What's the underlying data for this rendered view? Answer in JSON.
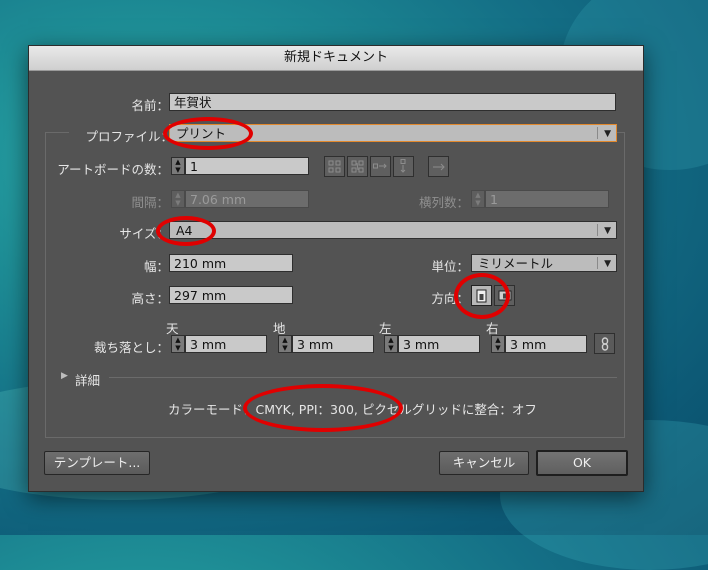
{
  "dialog": {
    "title": "新規ドキュメント",
    "name_label": "名前：",
    "name_value": "年賀状",
    "profile_label": "プロファイル：",
    "profile_value": "プリント",
    "artboards_label": "アートボードの数：",
    "artboards_value": "1",
    "spacing_label": "間隔：",
    "spacing_value": "7.06 mm",
    "columns_label": "横列数：",
    "columns_value": "1",
    "size_label": "サイズ：",
    "size_value": "A4",
    "width_label": "幅：",
    "width_value": "210 mm",
    "units_label": "単位：",
    "units_value": "ミリメートル",
    "height_label": "高さ：",
    "height_value": "297 mm",
    "orientation_label": "方向：",
    "bleed_label": "裁ち落とし：",
    "bleed": [
      {
        "label": "天",
        "value": "3 mm"
      },
      {
        "label": "地",
        "value": "3 mm"
      },
      {
        "label": "左",
        "value": "3 mm"
      },
      {
        "label": "右",
        "value": "3 mm"
      }
    ],
    "advanced_label": "詳細",
    "summary": "カラーモード：CMYK, PPI：300, ピクセルグリッドに整合：オフ",
    "template_button": "テンプレート...",
    "cancel_button": "キャンセル",
    "ok_button": "OK"
  },
  "colors": {
    "highlight_annotation": "#e00000",
    "dialog_bg": "#535353",
    "profile_focus": "#e2892d"
  },
  "icons": {
    "arrange_grid_by_row": "grid-by-row-icon",
    "arrange_grid_by_column": "grid-by-column-icon",
    "arrange_by_row": "arrange-by-row-icon",
    "arrange_by_column": "arrange-by-column-icon",
    "right_to_left": "right-to-left-icon",
    "portrait": "portrait-icon",
    "landscape": "landscape-icon",
    "link": "link-icon"
  }
}
